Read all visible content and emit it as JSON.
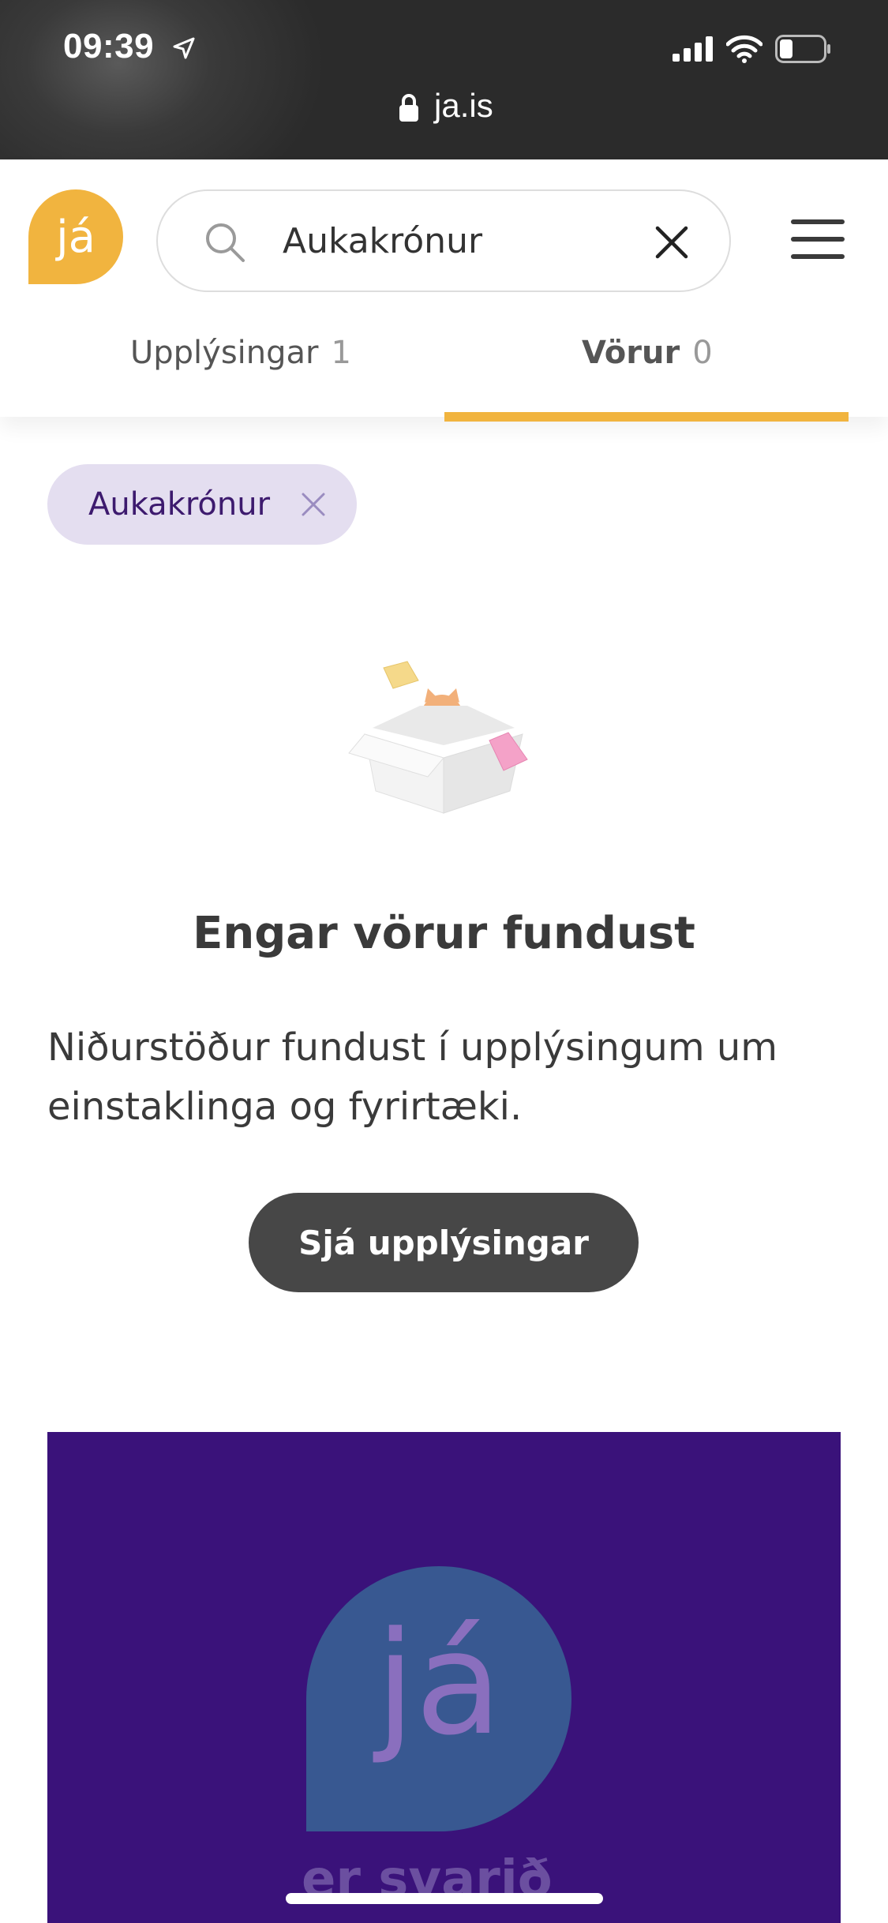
{
  "status_bar": {
    "time": "09:39",
    "url": "ja.is",
    "icons": [
      "location-arrow-icon",
      "signal-icon",
      "wifi-icon",
      "battery-icon",
      "lock-icon"
    ]
  },
  "header": {
    "logo_text": "já",
    "search": {
      "value": "Aukakrónur",
      "placeholder": ""
    },
    "tabs": [
      {
        "label": "Upplýsingar",
        "count": "1",
        "active": false
      },
      {
        "label": "Vörur",
        "count": "0",
        "active": true
      }
    ]
  },
  "filter_chip": {
    "label": "Aukakrónur"
  },
  "empty_state": {
    "title": "Engar vörur fundust",
    "description": "Niðurstöður fundust í upplýsingum um einstaklinga og fyrirtæki.",
    "button_label": "Sjá upplýsingar"
  },
  "promo": {
    "logo_text": "já",
    "tagline": "er svarið"
  },
  "colors": {
    "brand_yellow": "#f1b43f",
    "brand_purple": "#3a127a",
    "chip_bg": "#e4def0",
    "button_dark": "#474747",
    "promo_bubble": "#385891"
  }
}
